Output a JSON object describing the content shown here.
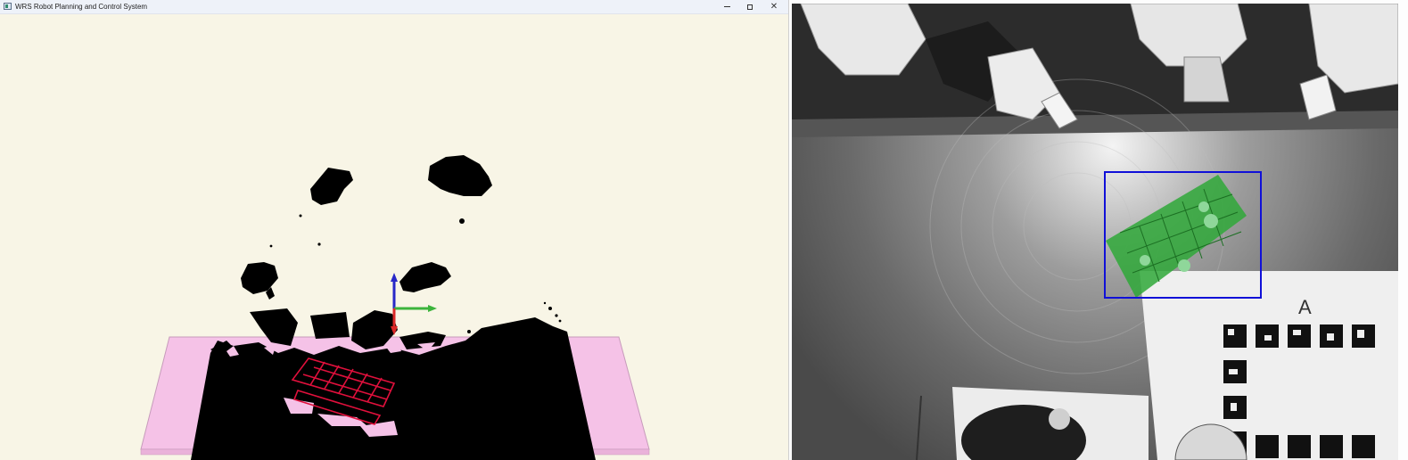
{
  "window": {
    "title": "WRS Robot Planning and Control System",
    "controls": {
      "minimize": "minimize",
      "maximize": "maximize",
      "close": "close"
    }
  },
  "viewport": {
    "background": "#f8f5e6",
    "table_color": "#f5c2e7",
    "pointcloud_color": "#000000",
    "rack_color": "#e0103c",
    "axes": {
      "x_color": "#3cb43c",
      "y_color": "#2828c8",
      "z_color": "#dc2828"
    }
  },
  "camera": {
    "detection_box_color": "#1010d8",
    "detection_fill_color": "#2fa838",
    "marker_board_label": "A"
  }
}
